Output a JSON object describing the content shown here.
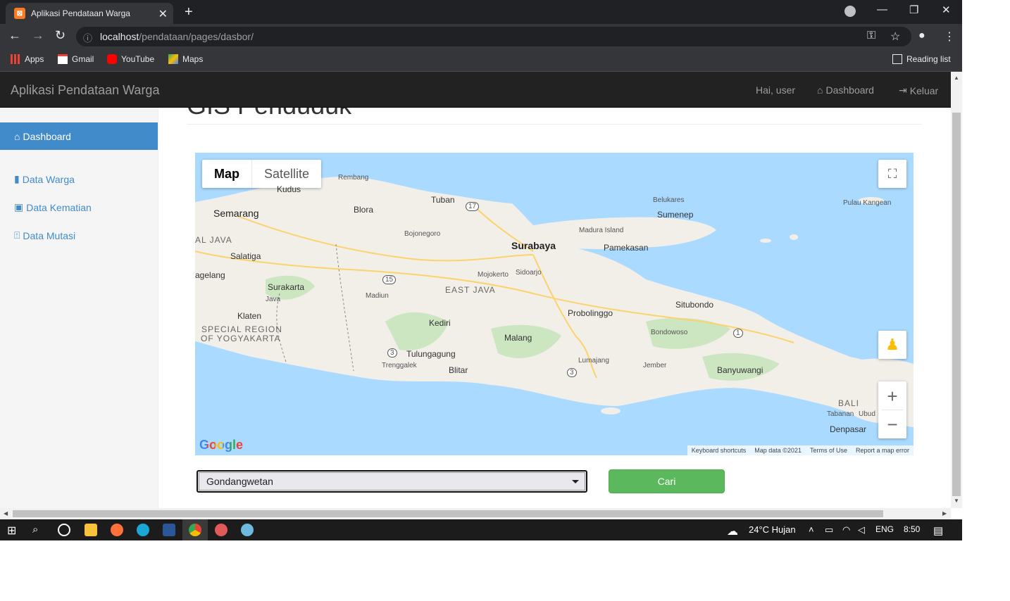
{
  "browser": {
    "tab_title": "Aplikasi Pendataan Warga",
    "url_host": "localhost",
    "url_path": "/pendataan/pages/dasbor/",
    "bookmarks": [
      "Apps",
      "Gmail",
      "YouTube",
      "Maps"
    ],
    "reading_list": "Reading list"
  },
  "navbar": {
    "brand": "Aplikasi Pendataan Warga",
    "greeting": "Hai, user",
    "dashboard": "Dashboard",
    "logout": "Keluar"
  },
  "sidebar": {
    "items": [
      {
        "label": "Dashboard",
        "icon": "home-icon",
        "active": true
      },
      {
        "label": "Data Warga",
        "icon": "book-icon"
      },
      {
        "label": "Data Kematian",
        "icon": "inbox-icon"
      },
      {
        "label": "Data Mutasi",
        "icon": "user-upload-icon"
      }
    ]
  },
  "page": {
    "title": "GIS Penduduk"
  },
  "map": {
    "type_map": "Map",
    "type_satellite": "Satellite",
    "attribution": [
      "Keyboard shortcuts",
      "Map data ©2021",
      "Terms of Use",
      "Report a map error"
    ],
    "logo": "Google",
    "places": {
      "semarang": "Semarang",
      "kudus": "Kudus",
      "rembang": "Rembang",
      "tuban": "Tuban",
      "blora": "Blora",
      "bojonegoro": "Bojonegoro",
      "surabaya": "Surabaya",
      "madura": "Madura Island",
      "pamekasan": "Pamekasan",
      "sumenep": "Sumenep",
      "belukares": "Belukares",
      "kangean": "Pulau Kangean",
      "jateng": "AL JAVA",
      "salatiga": "Salatiga",
      "magelang": "agelang",
      "surakarta": "Surakarta",
      "java": "Java",
      "klaten": "Klaten",
      "diy1": "SPECIAL REGION",
      "diy2": "OF YOGYAKARTA",
      "madiun": "Madiun",
      "mojokerto": "Mojokerto",
      "sidoarjo": "Sidoarjo",
      "jatim": "EAST JAVA",
      "kediri": "Kediri",
      "tulungagung": "Tulungagung",
      "trenggalek": "Trenggalek",
      "blitar": "Blitar",
      "malang": "Malang",
      "lumajang": "Lumajang",
      "probolinggo": "Probolinggo",
      "situbondo": "Situbondo",
      "bondowoso": "Bondowoso",
      "jember": "Jember",
      "banyuwangi": "Banyuwangi",
      "bali": "BALI",
      "tabanan": "Tabanan",
      "ubud": "Ubud",
      "denpasar": "Denpasar",
      "r17": "17",
      "r15": "15",
      "r3a": "3",
      "r3b": "3",
      "r1": "1"
    }
  },
  "form": {
    "selected": "Gondangwetan",
    "button": "Cari"
  },
  "taskbar": {
    "weather": "24°C  Hujan",
    "lang": "ENG",
    "time": "8:50"
  },
  "colors": {
    "primary": "#428bca",
    "success": "#5cb85c",
    "navbar": "#222222",
    "sea": "#aadaff",
    "land": "#f2efe9",
    "green": "#cbe6c0"
  }
}
